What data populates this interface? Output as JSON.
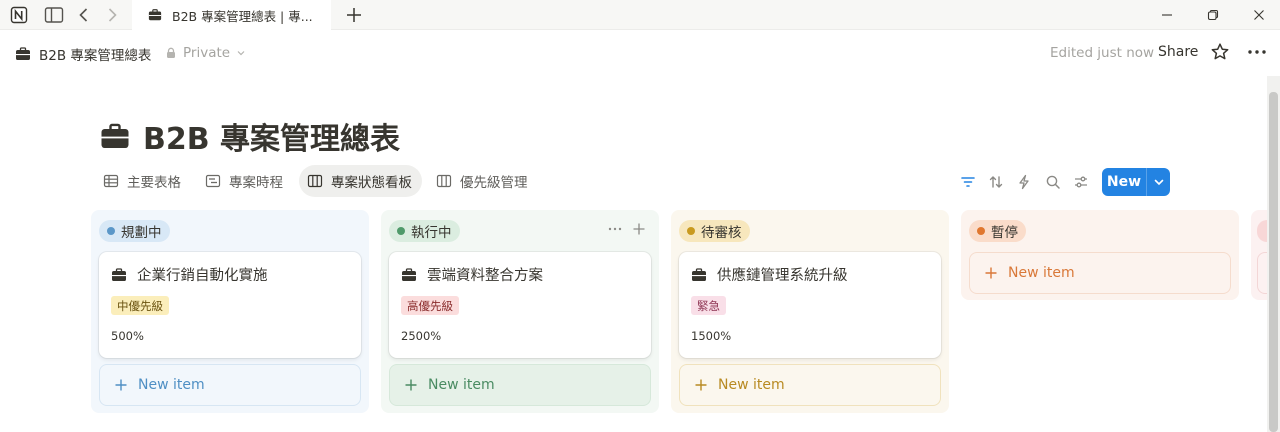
{
  "window": {
    "tab_title": "B2B 專案管理總表 | 專..."
  },
  "header": {
    "breadcrumb_title": "B2B 專案管理總表",
    "privacy": "Private",
    "edited": "Edited just now",
    "share": "Share"
  },
  "page": {
    "title": "B2B 專案管理總表"
  },
  "views": [
    {
      "label": "主要表格",
      "icon": "table-icon"
    },
    {
      "label": "專案時程",
      "icon": "timeline-icon"
    },
    {
      "label": "專案狀態看板",
      "icon": "board-icon",
      "active": true
    },
    {
      "label": "優先級管理",
      "icon": "board-icon"
    }
  ],
  "toolbar": {
    "new_label": "New"
  },
  "board": {
    "new_item_label": "New item",
    "columns": [
      {
        "name": "規劃中",
        "colors": {
          "bg": "#f2f7fc",
          "pill": "#d8e8f6",
          "dot": "#5b97c8",
          "new_item_text": "#4f8fc4",
          "new_item_border": "#d7e6f3"
        },
        "cards": [
          {
            "title": "企業行銷自動化實施",
            "tag": "中優先級",
            "tag_bg": "#fbeebb",
            "tag_color": "#6b5310",
            "percent": "500%"
          }
        ]
      },
      {
        "name": "執行中",
        "colors": {
          "bg": "#f3f8f4",
          "pill": "#dbede0",
          "dot": "#4f9a6a",
          "new_item_text": "#4a8b62",
          "new_item_border": "#d6e8da",
          "new_item_bg": "#e6f1e8"
        },
        "cards": [
          {
            "title": "雲端資料整合方案",
            "tag": "高優先級",
            "tag_bg": "#fbdddd",
            "tag_color": "#8a2c2c",
            "percent": "2500%"
          }
        ]
      },
      {
        "name": "待審核",
        "colors": {
          "bg": "#fbf7ee",
          "pill": "#f7e7bd",
          "dot": "#c99a1e",
          "new_item_text": "#b88a22",
          "new_item_border": "#f0e2bd"
        },
        "cards": [
          {
            "title": "供應鏈管理系統升級",
            "tag": "緊急",
            "tag_bg": "#f9dfe8",
            "tag_color": "#8d3352",
            "percent": "1500%"
          }
        ]
      },
      {
        "name": "暫停",
        "colors": {
          "bg": "#fcf3ee",
          "pill": "#fadcca",
          "dot": "#e0772f",
          "new_item_text": "#d97838",
          "new_item_border": "#f5dccd"
        },
        "cards": []
      }
    ]
  }
}
